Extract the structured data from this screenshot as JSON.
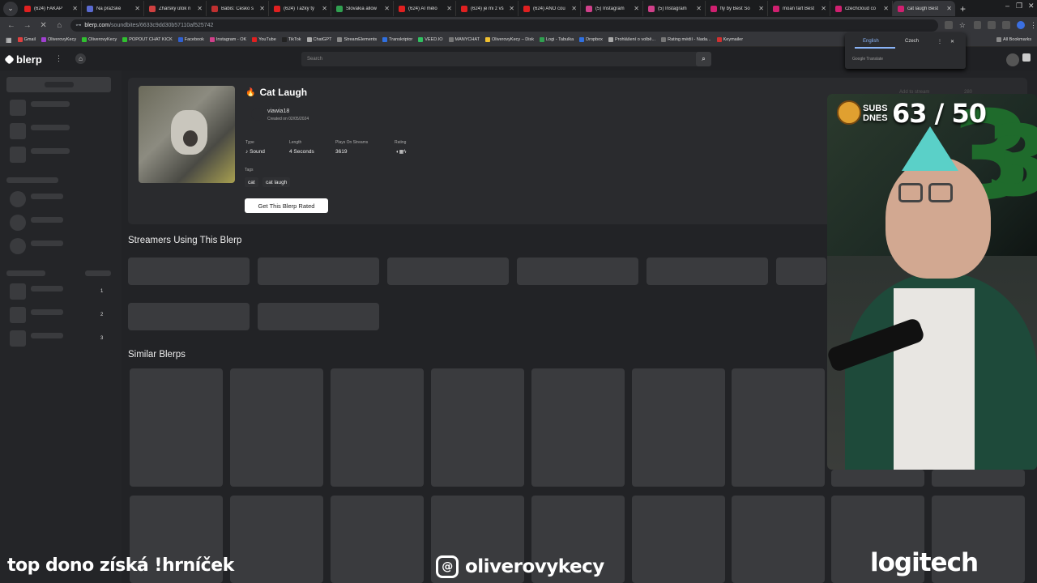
{
  "browser": {
    "tabs": [
      {
        "title": "(624) FAKAP",
        "color": "#e02020"
      },
      {
        "title": "Na pražské",
        "color": "#5a6ad0"
      },
      {
        "title": "Žháŕský útok n",
        "color": "#d04040"
      },
      {
        "title": "Babiš: Česko s",
        "color": "#c03030"
      },
      {
        "title": "(624) Ťažký tý",
        "color": "#e02020"
      },
      {
        "title": "Slovakia allow",
        "color": "#30a050"
      },
      {
        "title": "(624) AI mělo",
        "color": "#e02020"
      },
      {
        "title": "(624) je mi z vš",
        "color": "#e02020"
      },
      {
        "title": "(624) ANO cou",
        "color": "#e02020"
      },
      {
        "title": "(5) Instagram",
        "color": "#d0408a"
      },
      {
        "title": "(5) Instagram",
        "color": "#d0408a"
      },
      {
        "title": "fly by Best So",
        "color": "#d02070"
      },
      {
        "title": "moan fart Best",
        "color": "#d02070"
      },
      {
        "title": "czechcloud co",
        "color": "#d02070"
      },
      {
        "title": "cat laugh Best",
        "color": "#d02070"
      }
    ],
    "new_tab": "+",
    "url_host": "blerp.com",
    "url_path": "/soundbites/6633c9dd30b57110af525742",
    "bookmarks": [
      {
        "label": "Gmail",
        "color": "#e04040"
      },
      {
        "label": "OliverovyKecy",
        "color": "#a040d0"
      },
      {
        "label": "OliverovyKecy",
        "color": "#30c030"
      },
      {
        "label": "POPOUT CHAT KICK",
        "color": "#30c030"
      },
      {
        "label": "Facebook",
        "color": "#3060d0"
      },
      {
        "label": "Instagram - OK",
        "color": "#d0408a"
      },
      {
        "label": "YouTube",
        "color": "#e02020"
      },
      {
        "label": "TikTok",
        "color": "#222222"
      },
      {
        "label": "ChatGPT",
        "color": "#aaaaaa"
      },
      {
        "label": "StreamElements",
        "color": "#888888"
      },
      {
        "label": "Transkriptor",
        "color": "#3070e0"
      },
      {
        "label": "VEED.IO",
        "color": "#30c060"
      },
      {
        "label": "MANYCHAT",
        "color": "#777777"
      },
      {
        "label": "OliverovyKecy – Disk",
        "color": "#f0c030"
      },
      {
        "label": "Logi - Tabulka",
        "color": "#30a050"
      },
      {
        "label": "Dropbox",
        "color": "#3070e0"
      },
      {
        "label": "Prohlášení o volbě...",
        "color": "#aaaaaa"
      },
      {
        "label": "Rating médií - Nada...",
        "color": "#777777"
      },
      {
        "label": "Keymailer",
        "color": "#d03030"
      }
    ],
    "all_bookmarks": "All Bookmarks",
    "translate": {
      "lang1": "English",
      "lang2": "Czech",
      "hint": "Google Translate"
    }
  },
  "blerp": {
    "logo": "blerp",
    "search_placeholder": "Search",
    "title": "Cat Laugh",
    "author": "viawia18",
    "created": "Created on 02/05/2024",
    "meta": {
      "type_label": "Type",
      "type_value": "Sound",
      "length_label": "Length",
      "length_value": "4 Seconds",
      "plays_label": "Plays On Streams",
      "plays_value": "3619",
      "rating_label": "Rating"
    },
    "tags_label": "Tags",
    "tags": [
      "cat",
      "cat laugh"
    ],
    "rate_button": "Get This Blerp Rated",
    "add_to_stream": "Add to stream",
    "count": "280",
    "streamers_heading": "Streamers Using This Blerp",
    "similar_heading": "Similar Blerps",
    "sidebar_numbers": [
      "1",
      "2",
      "3"
    ]
  },
  "stream": {
    "goal_label_1": "SUBS",
    "goal_label_2": "DNES",
    "goal_value": "63 / 50",
    "promo_text": "top dono získá !hrníček",
    "handle": "oliverovykecy",
    "sponsor": "logitech"
  }
}
